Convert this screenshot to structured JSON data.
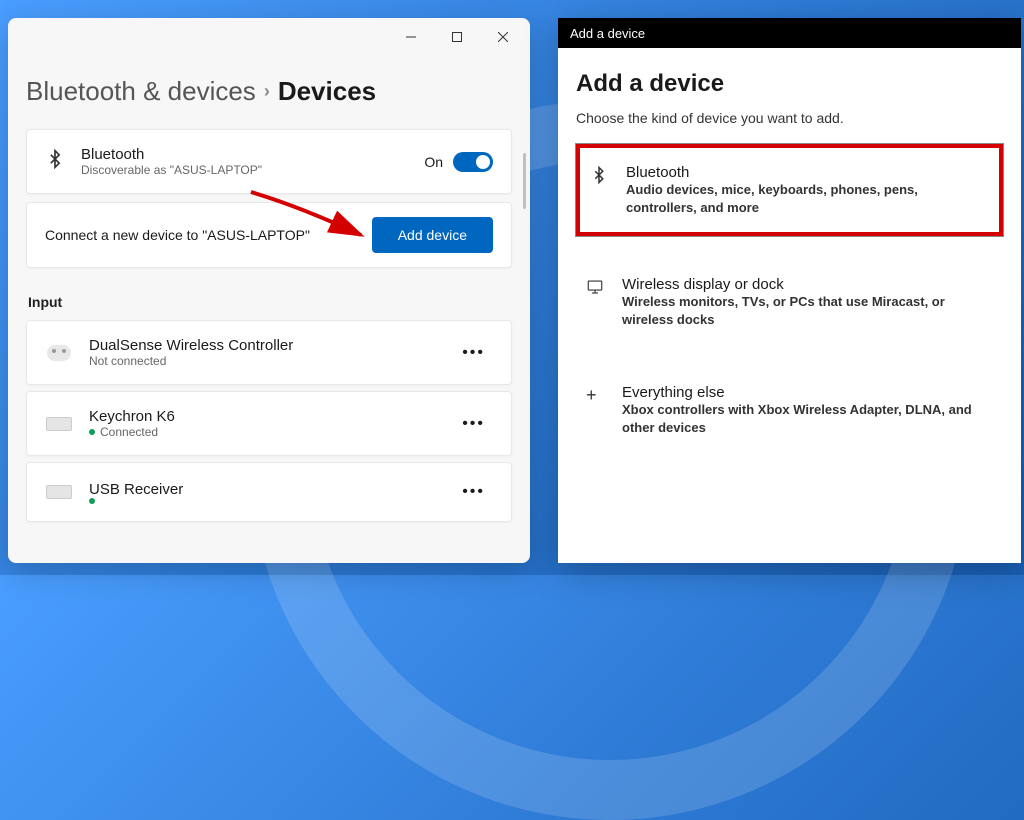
{
  "settings": {
    "breadcrumb": {
      "parent": "Bluetooth & devices",
      "current": "Devices"
    },
    "bluetooth": {
      "title": "Bluetooth",
      "subtitle": "Discoverable as \"ASUS-LAPTOP\"",
      "state_label": "On"
    },
    "connect": {
      "text": "Connect a new device to \"ASUS-LAPTOP\"",
      "button": "Add device"
    },
    "section_input": "Input",
    "devices": [
      {
        "name": "DualSense Wireless Controller",
        "status": "Not connected",
        "connected": false,
        "icon": "controller"
      },
      {
        "name": "Keychron K6",
        "status": "Connected",
        "connected": true,
        "icon": "keyboard"
      },
      {
        "name": "USB Receiver",
        "status": "",
        "connected": true,
        "icon": "keyboard"
      }
    ]
  },
  "dialog": {
    "titlebar": "Add a device",
    "heading": "Add a device",
    "subheading": "Choose the kind of device you want to add.",
    "options": [
      {
        "title": "Bluetooth",
        "desc": "Audio devices, mice, keyboards, phones, pens, controllers, and more",
        "highlighted": true
      },
      {
        "title": "Wireless display or dock",
        "desc": "Wireless monitors, TVs, or PCs that use Miracast, or wireless docks",
        "highlighted": false
      },
      {
        "title": "Everything else",
        "desc": "Xbox controllers with Xbox Wireless Adapter, DLNA, and other devices",
        "highlighted": false
      }
    ]
  }
}
